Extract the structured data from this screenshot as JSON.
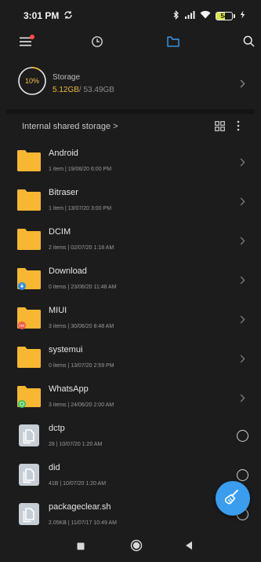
{
  "status_bar": {
    "time": "3:01 PM",
    "battery_text": "54",
    "battery_level_percent": 54
  },
  "colors": {
    "accent": "#3a9dee",
    "folder": "#f7b731",
    "storage_used": "#f0b838",
    "notification_dot": "#ff4a4a"
  },
  "nav": {
    "icons": [
      "menu-icon",
      "clock-icon",
      "folder-icon",
      "search-icon"
    ]
  },
  "storage": {
    "percent_label": "10%",
    "percent_value": 10,
    "title": "Storage",
    "used": "5.12GB",
    "total": "/ 53.49GB"
  },
  "location": {
    "title": "Internal shared storage",
    "chevron": ">"
  },
  "files": [
    {
      "name": "Android",
      "meta": "1 item  |  19/06/20 6:00 PM",
      "type": "folder",
      "badge": null
    },
    {
      "name": "Bitraser",
      "meta": "1 item  |  13/07/20 3:00 PM",
      "type": "folder",
      "badge": null
    },
    {
      "name": "DCIM",
      "meta": "2 items  |  02/07/20 1:18 AM",
      "type": "folder",
      "badge": null
    },
    {
      "name": "Download",
      "meta": "0 items  |  23/06/20 11:48 AM",
      "type": "folder",
      "badge": "download"
    },
    {
      "name": "MIUI",
      "meta": "3 items  |  30/06/20 8:48 AM",
      "type": "folder",
      "badge": "miui"
    },
    {
      "name": "systemui",
      "meta": "0 items  |  13/07/20 2:59 PM",
      "type": "folder",
      "badge": null
    },
    {
      "name": "WhatsApp",
      "meta": "3 items  |  24/06/20 2:00 AM",
      "type": "folder",
      "badge": "whatsapp"
    },
    {
      "name": "dctp",
      "meta": "28  |  10/07/20 1:20 AM",
      "type": "file",
      "badge": null
    },
    {
      "name": "did",
      "meta": "41B  |  10/07/20 1:20 AM",
      "type": "file",
      "badge": null
    },
    {
      "name": "packageclear.sh",
      "meta": "2.05KB  |  11/07/17 10:49 AM",
      "type": "file",
      "badge": null
    }
  ]
}
